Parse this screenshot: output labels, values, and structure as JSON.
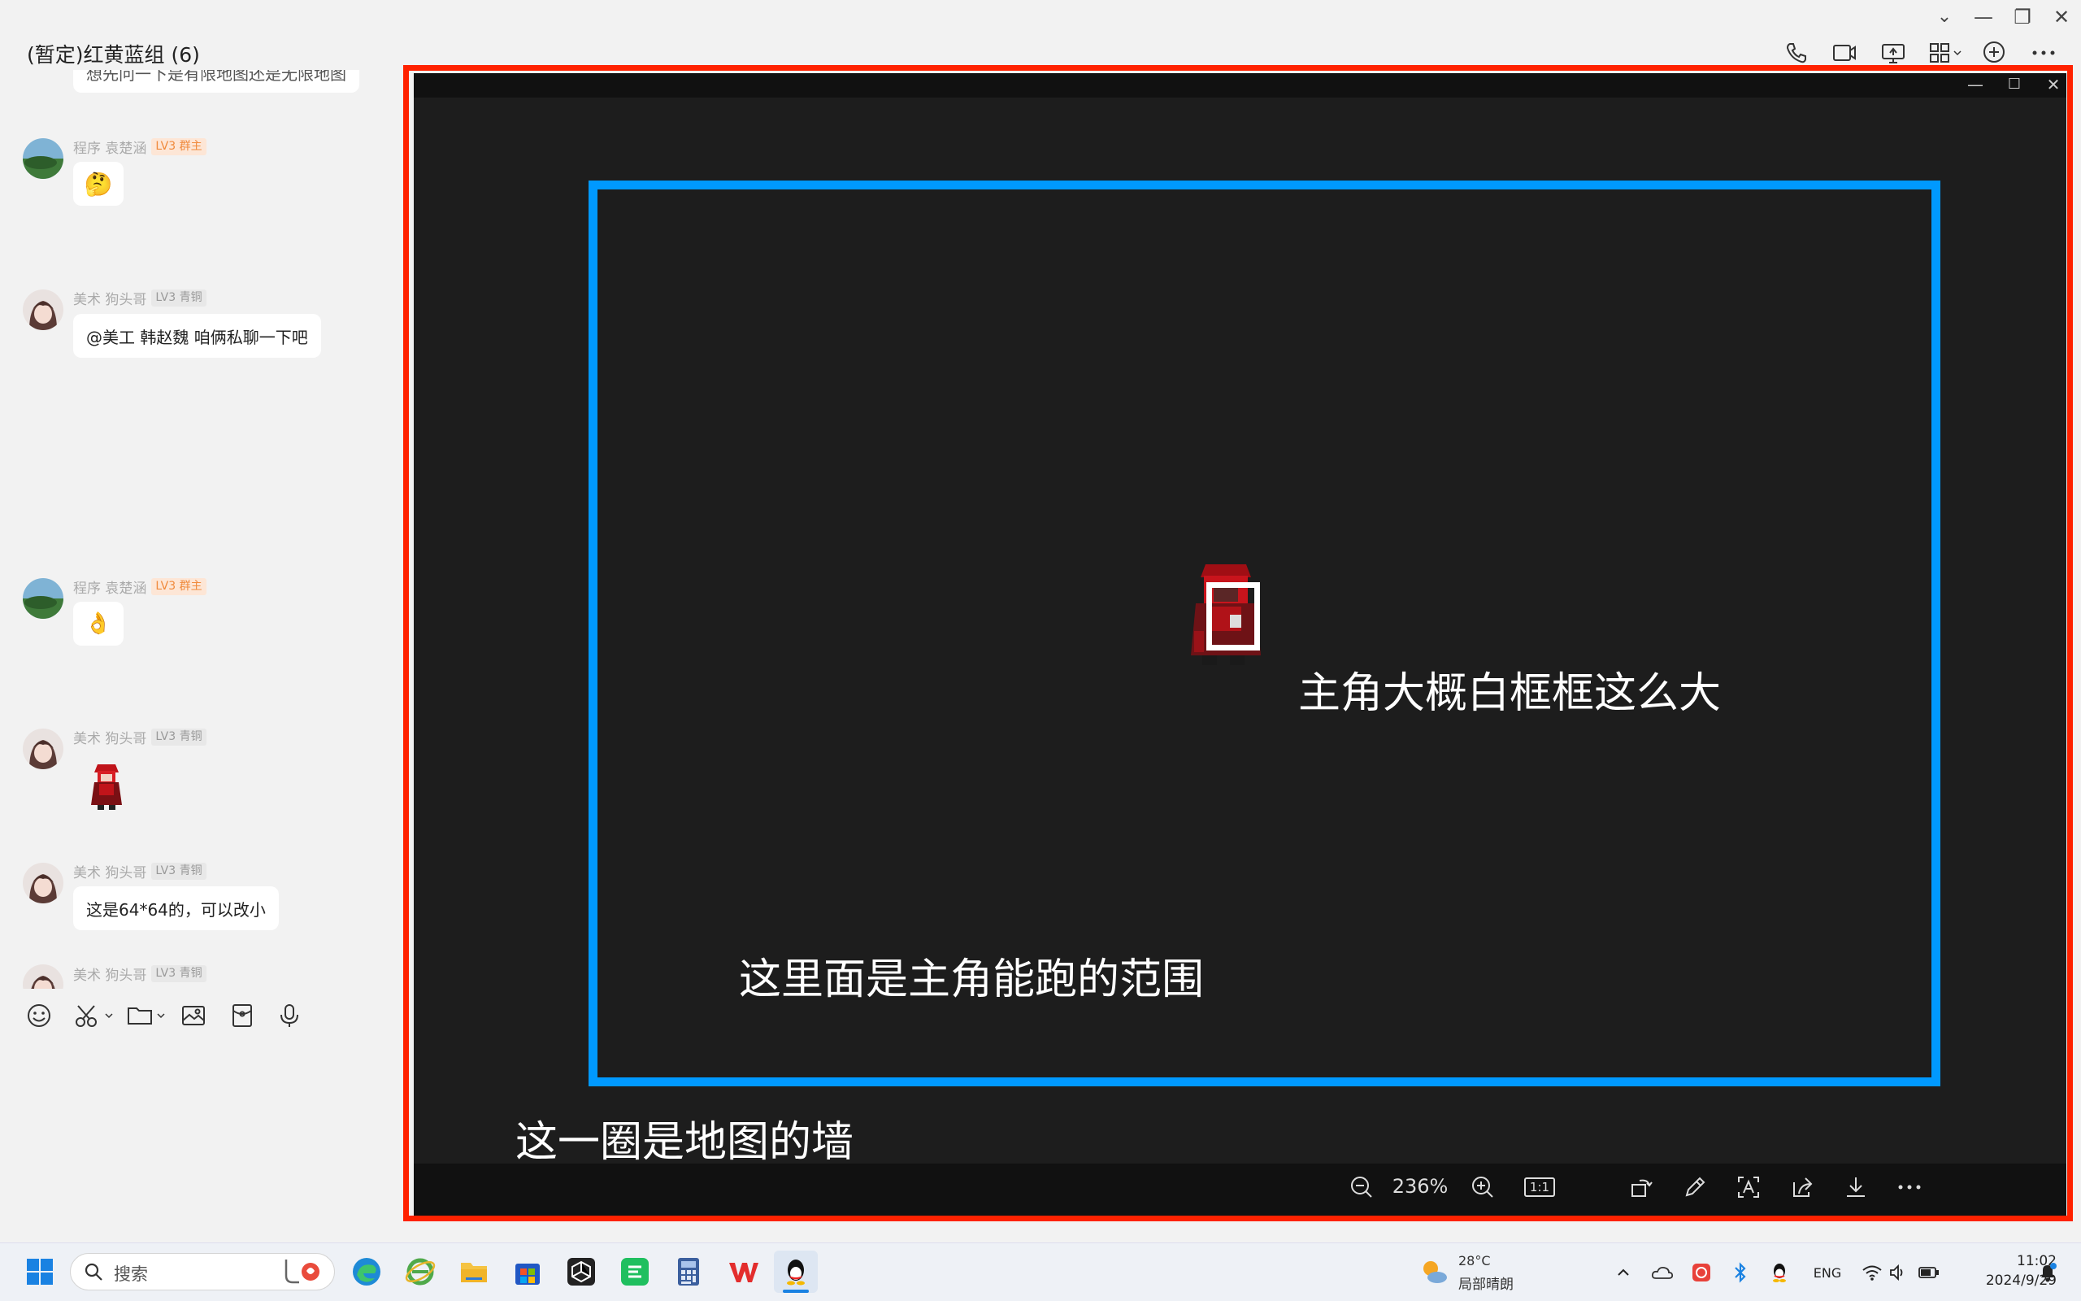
{
  "window": {
    "title": "(暂定)红黄蓝组 (6)",
    "controls": {
      "chevron": "⌄",
      "minimize": "—",
      "restore": "❐",
      "close": "✕"
    },
    "header_buttons": [
      "phone-icon",
      "video-call-icon",
      "screen-share-icon",
      "apps-icon",
      "add-member-icon",
      "more-icon"
    ]
  },
  "chat": {
    "partial_top_message": "想先问一下是有限地图还是无限地图",
    "messages": [
      {
        "sender": "程序 袁楚涵",
        "badge": "LV3 群主",
        "badge_type": "owner",
        "content": "🤔"
      },
      {
        "sender": "美术 狗头哥",
        "badge": "LV3 青铜",
        "badge_type": "bronze",
        "content": "@美工 韩赵魏 咱俩私聊一下吧"
      },
      {
        "sender": "程序 袁楚涵",
        "badge": "LV3 群主",
        "badge_type": "owner",
        "content": "👌"
      },
      {
        "sender": "美术 狗头哥",
        "badge": "LV3 青铜",
        "badge_type": "bronze",
        "content": "sprite"
      },
      {
        "sender": "美术 狗头哥",
        "badge": "LV3 青铜",
        "badge_type": "bronze",
        "content": "这是64*64的，可以改小"
      },
      {
        "sender": "美术 狗头哥",
        "badge": "LV3 青铜",
        "badge_type": "bronze",
        "content": ""
      }
    ],
    "toolbar": [
      "emoji-icon",
      "screenshot-icon",
      "folder-icon",
      "image-icon",
      "red-packet-icon",
      "voice-icon"
    ]
  },
  "viewer": {
    "controls": {
      "minimize": "—",
      "maximize": "☐",
      "close": "✕"
    },
    "annotation_hero": "主角大概白框框这么大",
    "annotation_range": "这里面是主角能跑的范围",
    "annotation_wall": "这一圈是地图的墙",
    "zoom_level": "236%",
    "one_to_one": "1:1",
    "colors": {
      "wall_outline": "#ff2200",
      "range_box": "#0099ff",
      "hero_box": "#ffffff"
    }
  },
  "taskbar": {
    "search_placeholder": "搜索",
    "apps": [
      "windows-start-icon",
      "edge-icon",
      "ie-icon",
      "file-explorer-icon",
      "store-icon",
      "unity-icon",
      "wechat-icon",
      "calculator-icon",
      "wps-icon",
      "qq-icon"
    ],
    "weather_temp": "28°C",
    "weather_desc": "局部晴朗",
    "input_lang": "ENG",
    "time": "11:02",
    "date": "2024/9/29"
  }
}
